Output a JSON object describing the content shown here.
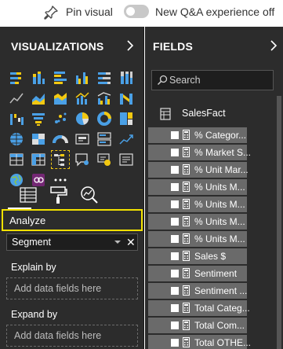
{
  "topbar": {
    "pin_label": "Pin visual",
    "toggle_state": "off",
    "qa_label": "New Q&A experience off"
  },
  "viz_pane": {
    "title": "VISUALIZATIONS",
    "visual_icons": [
      "stacked-bar-icon",
      "stacked-column-icon",
      "clustered-bar-icon",
      "clustered-column-icon",
      "100-bar-icon",
      "100-column-icon",
      "line-chart-icon",
      "area-chart-icon",
      "stacked-area-icon",
      "line-column-icon",
      "line-clustered-column-icon",
      "ribbon-chart-icon",
      "waterfall-icon",
      "funnel-icon",
      "scatter-icon",
      "pie-icon",
      "donut-icon",
      "treemap-icon",
      "map-icon",
      "filled-map-icon",
      "gauge-icon",
      "card-icon",
      "multirow-card-icon",
      "kpi-icon",
      "table-visual-icon",
      "matrix-icon",
      "decomposition-tree-icon",
      "qa-icon",
      "key-influencers-icon",
      "smart-narrative-icon",
      "arcgis-icon",
      "power-apps-icon",
      "more-visuals-icon"
    ],
    "tools": [
      "fields-tool-icon",
      "format-paintroller-icon",
      "analytics-magnifier-icon"
    ],
    "analyze_label": "Analyze",
    "segment_value": "Segment",
    "segment_clear": "✕",
    "explain_by_label": "Explain by",
    "explain_by_placeholder": "Add data fields here",
    "expand_by_label": "Expand by",
    "expand_by_placeholder": "Add data fields here"
  },
  "fields_pane": {
    "title": "FIELDS",
    "search_placeholder": "Search",
    "table_name": "SalesFact",
    "fields": [
      "% Categor...",
      "% Market S...",
      "% Unit Mar...",
      "% Units M...",
      "% Units M...",
      "% Units M...",
      "% Units M...",
      "Sales $",
      "Sentiment",
      "Sentiment ...",
      "Total Categ...",
      "Total Com...",
      "Total OTHE..."
    ]
  },
  "colors": {
    "pane_bg": "#2c2c2c",
    "highlight": "#f2e100",
    "field_row_bg": "#6a6a6a"
  }
}
